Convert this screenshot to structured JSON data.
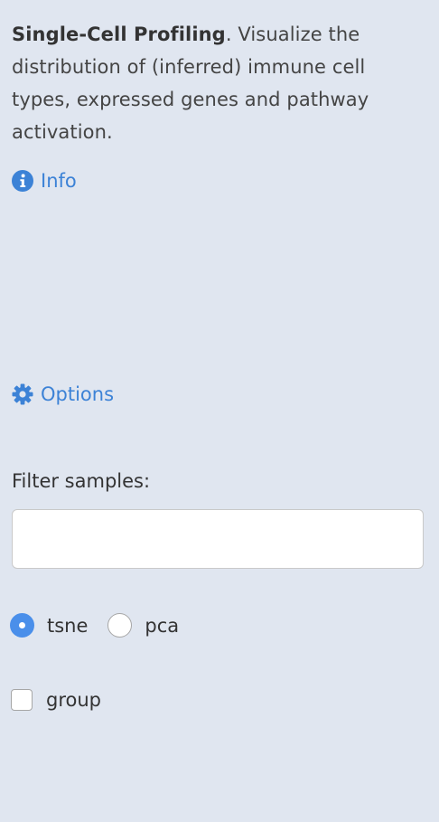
{
  "intro": {
    "title": "Single-Cell Profiling",
    "description": ". Visualize the distribution of (inferred) immune cell types, expressed genes and pathway activation."
  },
  "info": {
    "label": "Info",
    "icon": "info-circle-icon"
  },
  "options": {
    "label": "Options",
    "icon": "gear-icon"
  },
  "filter": {
    "label": "Filter samples:",
    "value": "",
    "placeholder": ""
  },
  "layout_radio": {
    "options": [
      {
        "label": "tsne",
        "selected": true
      },
      {
        "label": "pca",
        "selected": false
      }
    ]
  },
  "group_checkbox": {
    "label": "group",
    "checked": false
  },
  "colors": {
    "background": "#e0e6f0",
    "link": "#3c82d6",
    "radio_selected": "#4a8fea"
  }
}
